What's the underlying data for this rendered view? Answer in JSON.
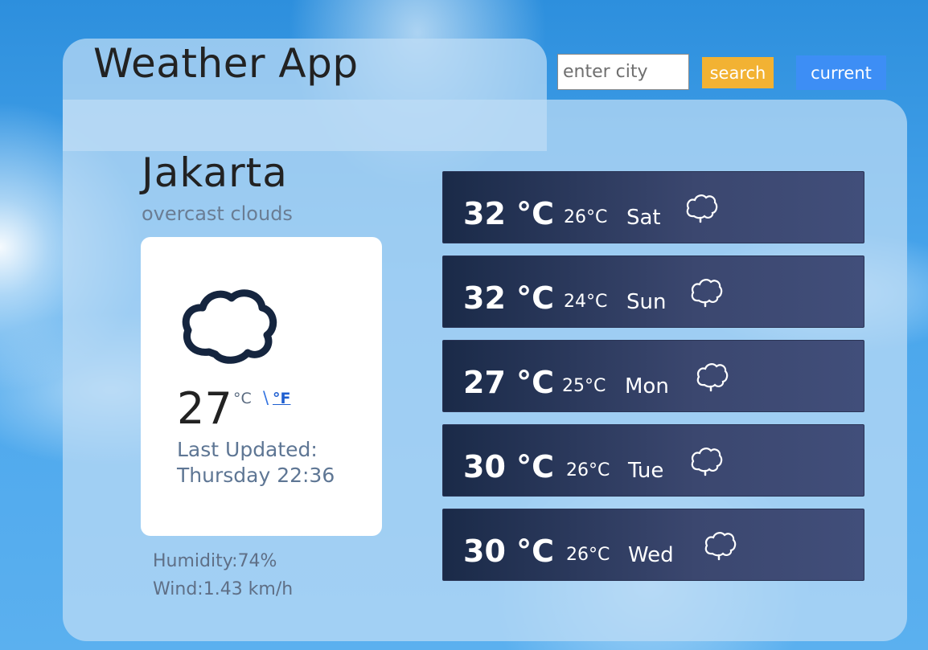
{
  "app": {
    "title": "Weather App"
  },
  "search": {
    "placeholder": "enter city",
    "value": "",
    "button_label": "search",
    "current_label": "current"
  },
  "current": {
    "city": "Jakarta",
    "description": "overcast clouds",
    "icon": "cloud-icon",
    "temperature": "27",
    "unit_c": "°C",
    "unit_separator": "\\",
    "unit_f": "°F",
    "last_updated_label": "Last Updated:",
    "last_updated_value": "Thursday 22:36",
    "humidity": "Humidity:74%",
    "wind": "Wind:1.43 km/h"
  },
  "forecast": [
    {
      "high": "32 °C",
      "low": "26°C",
      "day": "Sat",
      "icon": "rain-cloud-icon"
    },
    {
      "high": "32 °C",
      "low": "24°C",
      "day": "Sun",
      "icon": "rain-cloud-icon"
    },
    {
      "high": "27 °C",
      "low": "25°C",
      "day": "Mon",
      "icon": "rain-cloud-icon"
    },
    {
      "high": "30 °C",
      "low": "26°C",
      "day": "Tue",
      "icon": "rain-cloud-icon"
    },
    {
      "high": "30 °C",
      "low": "26°C",
      "day": "Wed",
      "icon": "rain-cloud-icon"
    }
  ],
  "colors": {
    "search_button": "#f2b233",
    "current_button": "#3d8ef5",
    "forecast_bg": "#2a3556"
  }
}
